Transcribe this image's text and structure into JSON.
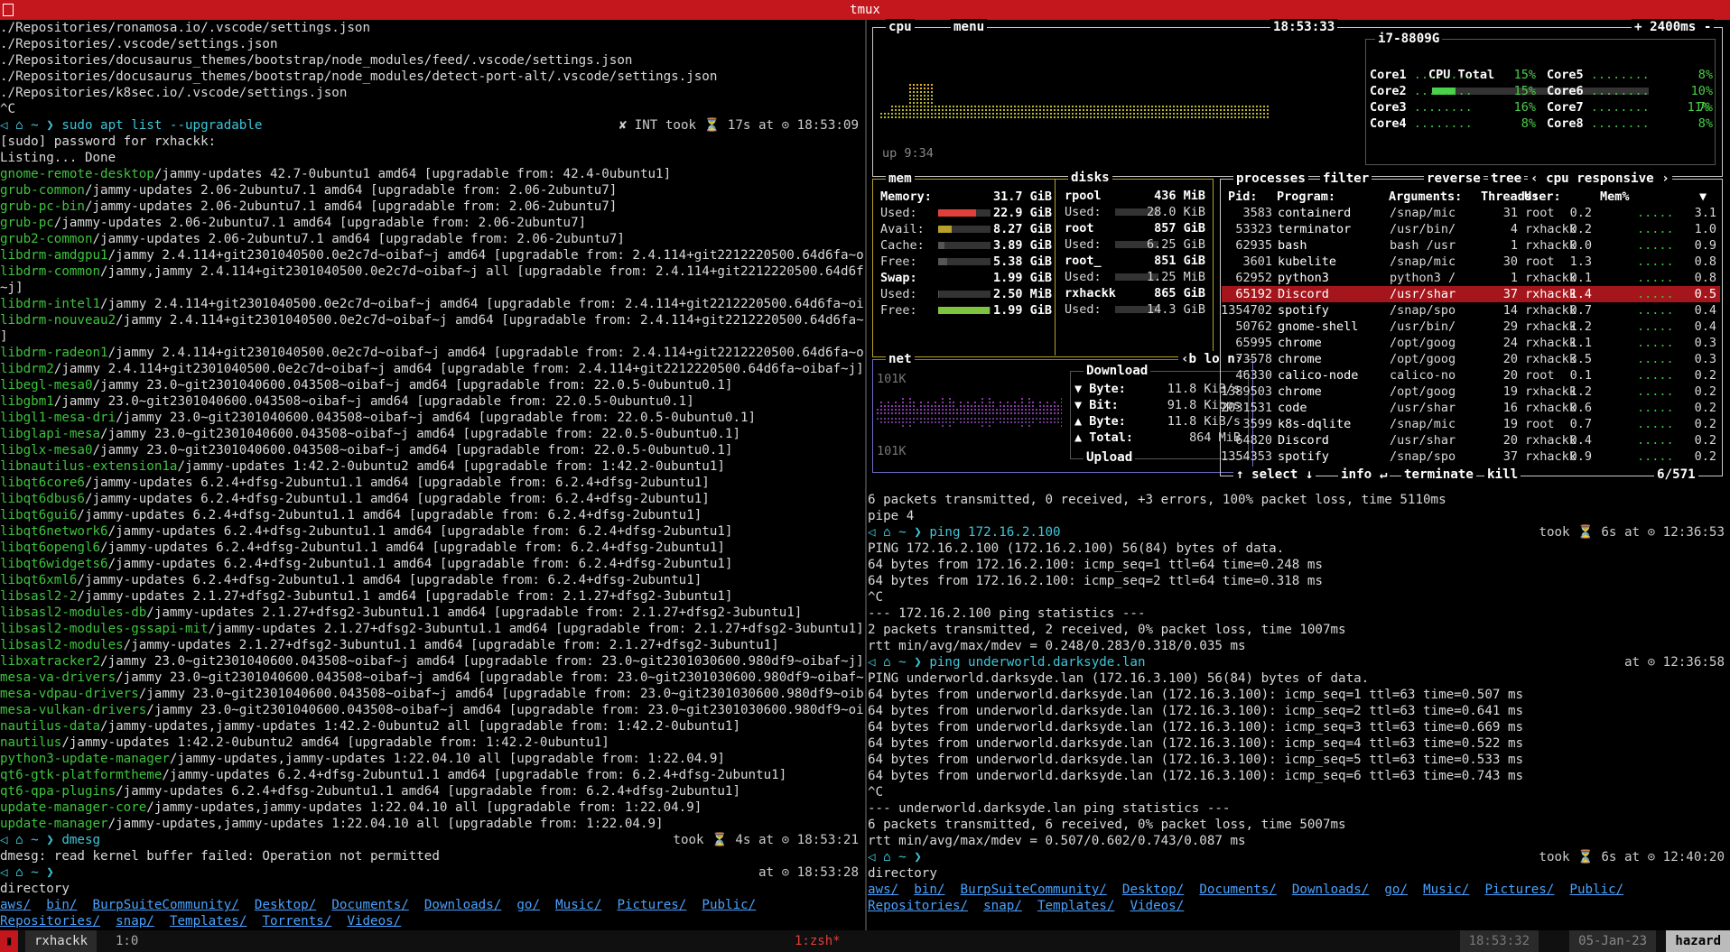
{
  "window": {
    "title": "tmux"
  },
  "left_pane": {
    "lines": [
      {
        "t": "./Repositories/ronamosa.io/.vscode/settings.json"
      },
      {
        "t": "./Repositories/.vscode/settings.json"
      },
      {
        "t": "./Repositories/docusaurus_themes/bootstrap/node_modules/feed/.vscode/settings.json"
      },
      {
        "t": "./Repositories/docusaurus_themes/bootstrap/node_modules/detect-port-alt/.vscode/settings.json"
      },
      {
        "t": "./Repositories/k8sec.io/.vscode/settings.json"
      },
      {
        "t": "^C"
      },
      {
        "t": "◁ ⌂ ~ ❯ sudo apt list --upgradable",
        "right": "✘ INT took ⏳ 17s at ⊙ 18:53:09",
        "prompt": true
      },
      {
        "t": "[sudo] password for rxhackk:"
      },
      {
        "t": "Listing... Done"
      },
      {
        "pkg": "gnome-remote-desktop",
        "t": "/jammy-updates 42.7-0ubuntu1 amd64 [upgradable from: 42.4-0ubuntu1]"
      },
      {
        "pkg": "grub-common",
        "t": "/jammy-updates 2.06-2ubuntu7.1 amd64 [upgradable from: 2.06-2ubuntu7]"
      },
      {
        "pkg": "grub-pc-bin",
        "t": "/jammy-updates 2.06-2ubuntu7.1 amd64 [upgradable from: 2.06-2ubuntu7]"
      },
      {
        "pkg": "grub-pc",
        "t": "/jammy-updates 2.06-2ubuntu7.1 amd64 [upgradable from: 2.06-2ubuntu7]"
      },
      {
        "pkg": "grub2-common",
        "t": "/jammy-updates 2.06-2ubuntu7.1 amd64 [upgradable from: 2.06-2ubuntu7]"
      },
      {
        "pkg": "libdrm-amdgpu1",
        "t": "/jammy 2.4.114+git2301040500.0e2c7d~oibaf~j amd64 [upgradable from: 2.4.114+git2212220500.64d6fa~oibaf~j]"
      },
      {
        "pkg": "libdrm-common",
        "t": "/jammy,jammy 2.4.114+git2301040500.0e2c7d~oibaf~j all [upgradable from: 2.4.114+git2212220500.64d6fa~oibaf"
      },
      {
        "t": "~j]"
      },
      {
        "pkg": "libdrm-intel1",
        "t": "/jammy 2.4.114+git2301040500.0e2c7d~oibaf~j amd64 [upgradable from: 2.4.114+git2212220500.64d6fa~oibaf~j]"
      },
      {
        "pkg": "libdrm-nouveau2",
        "t": "/jammy 2.4.114+git2301040500.0e2c7d~oibaf~j amd64 [upgradable from: 2.4.114+git2212220500.64d6fa~oibaf~j"
      },
      {
        "t": "]"
      },
      {
        "pkg": "libdrm-radeon1",
        "t": "/jammy 2.4.114+git2301040500.0e2c7d~oibaf~j amd64 [upgradable from: 2.4.114+git2212220500.64d6fa~oibaf~j]"
      },
      {
        "pkg": "libdrm2",
        "t": "/jammy 2.4.114+git2301040500.0e2c7d~oibaf~j amd64 [upgradable from: 2.4.114+git2212220500.64d6fa~oibaf~j]"
      },
      {
        "pkg": "libegl-mesa0",
        "t": "/jammy 23.0~git2301040600.043508~oibaf~j amd64 [upgradable from: 22.0.5-0ubuntu0.1]"
      },
      {
        "pkg": "libgbm1",
        "t": "/jammy 23.0~git2301040600.043508~oibaf~j amd64 [upgradable from: 22.0.5-0ubuntu0.1]"
      },
      {
        "pkg": "libgl1-mesa-dri",
        "t": "/jammy 23.0~git2301040600.043508~oibaf~j amd64 [upgradable from: 22.0.5-0ubuntu0.1]"
      },
      {
        "pkg": "libglapi-mesa",
        "t": "/jammy 23.0~git2301040600.043508~oibaf~j amd64 [upgradable from: 22.0.5-0ubuntu0.1]"
      },
      {
        "pkg": "libglx-mesa0",
        "t": "/jammy 23.0~git2301040600.043508~oibaf~j amd64 [upgradable from: 22.0.5-0ubuntu0.1]"
      },
      {
        "pkg": "libnautilus-extension1a",
        "t": "/jammy-updates 1:42.2-0ubuntu2 amd64 [upgradable from: 1:42.2-0ubuntu1]"
      },
      {
        "pkg": "libqt6core6",
        "t": "/jammy-updates 6.2.4+dfsg-2ubuntu1.1 amd64 [upgradable from: 6.2.4+dfsg-2ubuntu1]"
      },
      {
        "pkg": "libqt6dbus6",
        "t": "/jammy-updates 6.2.4+dfsg-2ubuntu1.1 amd64 [upgradable from: 6.2.4+dfsg-2ubuntu1]"
      },
      {
        "pkg": "libqt6gui6",
        "t": "/jammy-updates 6.2.4+dfsg-2ubuntu1.1 amd64 [upgradable from: 6.2.4+dfsg-2ubuntu1]"
      },
      {
        "pkg": "libqt6network6",
        "t": "/jammy-updates 6.2.4+dfsg-2ubuntu1.1 amd64 [upgradable from: 6.2.4+dfsg-2ubuntu1]"
      },
      {
        "pkg": "libqt6opengl6",
        "t": "/jammy-updates 6.2.4+dfsg-2ubuntu1.1 amd64 [upgradable from: 6.2.4+dfsg-2ubuntu1]"
      },
      {
        "pkg": "libqt6widgets6",
        "t": "/jammy-updates 6.2.4+dfsg-2ubuntu1.1 amd64 [upgradable from: 6.2.4+dfsg-2ubuntu1]"
      },
      {
        "pkg": "libqt6xml6",
        "t": "/jammy-updates 6.2.4+dfsg-2ubuntu1.1 amd64 [upgradable from: 6.2.4+dfsg-2ubuntu1]"
      },
      {
        "pkg": "libsasl2-2",
        "t": "/jammy-updates 2.1.27+dfsg2-3ubuntu1.1 amd64 [upgradable from: 2.1.27+dfsg2-3ubuntu1]"
      },
      {
        "pkg": "libsasl2-modules-db",
        "t": "/jammy-updates 2.1.27+dfsg2-3ubuntu1.1 amd64 [upgradable from: 2.1.27+dfsg2-3ubuntu1]"
      },
      {
        "pkg": "libsasl2-modules-gssapi-mit",
        "t": "/jammy-updates 2.1.27+dfsg2-3ubuntu1.1 amd64 [upgradable from: 2.1.27+dfsg2-3ubuntu1]"
      },
      {
        "pkg": "libsasl2-modules",
        "t": "/jammy-updates 2.1.27+dfsg2-3ubuntu1.1 amd64 [upgradable from: 2.1.27+dfsg2-3ubuntu1]"
      },
      {
        "pkg": "libxatracker2",
        "t": "/jammy 23.0~git2301040600.043508~oibaf~j amd64 [upgradable from: 23.0~git2301030600.980df9~oibaf~j]"
      },
      {
        "pkg": "mesa-va-drivers",
        "t": "/jammy 23.0~git2301040600.043508~oibaf~j amd64 [upgradable from: 23.0~git2301030600.980df9~oibaf~j]"
      },
      {
        "pkg": "mesa-vdpau-drivers",
        "t": "/jammy 23.0~git2301040600.043508~oibaf~j amd64 [upgradable from: 23.0~git2301030600.980df9~oibaf~j]"
      },
      {
        "pkg": "mesa-vulkan-drivers",
        "t": "/jammy 23.0~git2301040600.043508~oibaf~j amd64 [upgradable from: 23.0~git2301030600.980df9~oibaf~j]"
      },
      {
        "pkg": "nautilus-data",
        "t": "/jammy-updates,jammy-updates 1:42.2-0ubuntu2 all [upgradable from: 1:42.2-0ubuntu1]"
      },
      {
        "pkg": "nautilus",
        "t": "/jammy-updates 1:42.2-0ubuntu2 amd64 [upgradable from: 1:42.2-0ubuntu1]"
      },
      {
        "pkg": "python3-update-manager",
        "t": "/jammy-updates,jammy-updates 1:22.04.10 all [upgradable from: 1:22.04.9]"
      },
      {
        "pkg": "qt6-gtk-platformtheme",
        "t": "/jammy-updates 6.2.4+dfsg-2ubuntu1.1 amd64 [upgradable from: 6.2.4+dfsg-2ubuntu1]"
      },
      {
        "pkg": "qt6-qpa-plugins",
        "t": "/jammy-updates 6.2.4+dfsg-2ubuntu1.1 amd64 [upgradable from: 6.2.4+dfsg-2ubuntu1]"
      },
      {
        "pkg": "update-manager-core",
        "t": "/jammy-updates,jammy-updates 1:22.04.10 all [upgradable from: 1:22.04.9]"
      },
      {
        "pkg": "update-manager",
        "t": "/jammy-updates,jammy-updates 1:22.04.10 all [upgradable from: 1:22.04.9]"
      },
      {
        "t": "◁ ⌂ ~ ❯ dmesg",
        "right": "took ⏳ 4s at ⊙ 18:53:21",
        "prompt": true
      },
      {
        "t": "dmesg: read kernel buffer failed: Operation not permitted"
      },
      {
        "t": "◁ ⌂ ~ ❯",
        "right": "at ⊙ 18:53:28",
        "prompt": true
      },
      {
        "t": "directory"
      },
      {
        "dirs": [
          "aws/",
          "bin/",
          "BurpSuiteCommunity/",
          "Desktop/",
          "Documents/",
          "Downloads/",
          "go/",
          "Music/",
          "Pictures/",
          "Public/"
        ]
      },
      {
        "dirs": [
          "Repositories/",
          "snap/",
          "Templates/",
          "Torrents/",
          "Videos/"
        ]
      }
    ]
  },
  "right_pane": {
    "lines": [
      {
        "t": "6 packets transmitted, 0 received, +3 errors, 100% packet loss, time 5110ms"
      },
      {
        "t": "pipe 4"
      },
      {
        "t": "◁ ⌂ ~ ❯ ping 172.16.2.100",
        "right": "took ⏳ 6s at ⊙ 12:36:53",
        "prompt": true
      },
      {
        "t": "PING 172.16.2.100 (172.16.2.100) 56(84) bytes of data."
      },
      {
        "t": "64 bytes from 172.16.2.100: icmp_seq=1 ttl=64 time=0.248 ms"
      },
      {
        "t": "64 bytes from 172.16.2.100: icmp_seq=2 ttl=64 time=0.318 ms"
      },
      {
        "t": "^C"
      },
      {
        "t": "--- 172.16.2.100 ping statistics ---"
      },
      {
        "t": "2 packets transmitted, 2 received, 0% packet loss, time 1007ms"
      },
      {
        "t": "rtt min/avg/max/mdev = 0.248/0.283/0.318/0.035 ms"
      },
      {
        "t": "◁ ⌂ ~ ❯ ping underworld.darksyde.lan",
        "right": "at ⊙ 12:36:58",
        "prompt": true
      },
      {
        "t": "PING underworld.darksyde.lan (172.16.3.100) 56(84) bytes of data."
      },
      {
        "t": "64 bytes from underworld.darksyde.lan (172.16.3.100): icmp_seq=1 ttl=63 time=0.507 ms"
      },
      {
        "t": "64 bytes from underworld.darksyde.lan (172.16.3.100): icmp_seq=2 ttl=63 time=0.641 ms"
      },
      {
        "t": "64 bytes from underworld.darksyde.lan (172.16.3.100): icmp_seq=3 ttl=63 time=0.669 ms"
      },
      {
        "t": "64 bytes from underworld.darksyde.lan (172.16.3.100): icmp_seq=4 ttl=63 time=0.522 ms"
      },
      {
        "t": "64 bytes from underworld.darksyde.lan (172.16.3.100): icmp_seq=5 ttl=63 time=0.533 ms"
      },
      {
        "t": "64 bytes from underworld.darksyde.lan (172.16.3.100): icmp_seq=6 ttl=63 time=0.743 ms"
      },
      {
        "t": "^C"
      },
      {
        "t": "--- underworld.darksyde.lan ping statistics ---"
      },
      {
        "t": "6 packets transmitted, 6 received, 0% packet loss, time 5007ms"
      },
      {
        "t": "rtt min/avg/max/mdev = 0.507/0.602/0.743/0.087 ms"
      },
      {
        "t": "◁ ⌂ ~ ❯",
        "right": "took ⏳ 6s at ⊙ 12:40:20",
        "prompt": true
      },
      {
        "t": "directory"
      },
      {
        "dirs": [
          "aws/",
          "bin/",
          "BurpSuiteCommunity/",
          "Desktop/",
          "Documents/",
          "Downloads/",
          "go/",
          "Music/",
          "Pictures/",
          "Public/"
        ]
      },
      {
        "dirs": [
          "Repositories/",
          "snap/",
          "Templates/",
          "Videos/"
        ]
      }
    ]
  },
  "btop": {
    "cpu": {
      "tabs": [
        "cpu",
        "menu"
      ],
      "clock": "18:53:33",
      "rate": "+ 2400ms -",
      "model": "i7-8809G",
      "uptime": "up 9:34",
      "total_label": "CPU Total",
      "total": "11%",
      "total_fill": 0.11,
      "cores": [
        {
          "n": "Core1",
          "v": "15%"
        },
        {
          "n": "Core5",
          "v": "8%"
        },
        {
          "n": "Core2",
          "v": "15%"
        },
        {
          "n": "Core6",
          "v": "10%"
        },
        {
          "n": "Core3",
          "v": "16%"
        },
        {
          "n": "Core7",
          "v": "7%"
        },
        {
          "n": "Core4",
          "v": "8%"
        },
        {
          "n": "Core8",
          "v": "8%"
        }
      ]
    },
    "mem": {
      "title": "mem",
      "rows": [
        {
          "l": "Memory:",
          "v": "31.7 GiB",
          "bold": true
        },
        {
          "l": "Used:",
          "v": "22.9 GiB",
          "fill": 0.72,
          "color": "#e0403a"
        },
        {
          "l": "Avail:",
          "v": "8.27 GiB",
          "fill": 0.26,
          "color": "#b8a12a"
        },
        {
          "l": "Cache:",
          "v": "3.89 GiB",
          "fill": 0.12,
          "color": "#555"
        },
        {
          "l": "Free:",
          "v": "5.38 GiB",
          "fill": 0.17,
          "color": "#555"
        },
        {
          "l": "Swap:",
          "v": "1.99 GiB",
          "bold": true
        },
        {
          "l": "Used:",
          "v": "2.50 MiB",
          "fill": 0.01,
          "color": "#555"
        },
        {
          "l": "Free:",
          "v": "1.99 GiB",
          "fill": 0.99,
          "color": "#7ec43e"
        }
      ]
    },
    "disks": {
      "title": "disks",
      "rows": [
        {
          "l": "rpool",
          "v": "436 MiB",
          "bold": true
        },
        {
          "l": "Used:",
          "v": "28.0 KiB"
        },
        {
          "l": "root",
          "v": "857 GiB",
          "bold": true
        },
        {
          "l": "Used:",
          "v": "6.25 GiB"
        },
        {
          "l": "root_",
          "v": "851 GiB",
          "bold": true
        },
        {
          "l": "Used:",
          "v": "1.25 MiB"
        },
        {
          "l": "rxhackk",
          "v": "865 GiB",
          "bold": true
        },
        {
          "l": "Used:",
          "v": "14.3 GiB"
        }
      ]
    },
    "net": {
      "title": "net",
      "tabs": "‹b lo n›",
      "scale_top": "101K",
      "scale_bottom": "101K",
      "download_label": "Download",
      "upload_label": "Upload",
      "rows": [
        {
          "l": "▼ Byte:",
          "v": "11.8 KiB/s"
        },
        {
          "l": "▼ Bit:",
          "v": "91.8 Kibps"
        },
        {
          "l": "▲ Byte:",
          "v": "11.8 KiB/s"
        },
        {
          "l": "▲ Total:",
          "v": "864 MiB"
        }
      ]
    },
    "proc": {
      "tabs": [
        "processes",
        "filter",
        "reverse",
        "tree",
        "‹ cpu responsive ›"
      ],
      "headers": [
        "Pid:",
        "Program:",
        "Arguments:",
        "Threads:",
        "User:",
        "Mem%",
        "▼"
      ],
      "rows": [
        {
          "pid": "3583",
          "prog": "containerd",
          "args": "/snap/mic",
          "thr": "31",
          "user": "root",
          "mem": "0.2",
          "cpu": "3.1"
        },
        {
          "pid": "53323",
          "prog": "terminator",
          "args": "/usr/bin/",
          "thr": "4",
          "user": "rxhackk",
          "mem": "0.2",
          "cpu": "1.0"
        },
        {
          "pid": "62935",
          "prog": "bash",
          "args": "bash /usr",
          "thr": "1",
          "user": "rxhackk",
          "mem": "0.0",
          "cpu": "0.9"
        },
        {
          "pid": "3601",
          "prog": "kubelite",
          "args": "/snap/mic",
          "thr": "30",
          "user": "root",
          "mem": "1.3",
          "cpu": "0.8"
        },
        {
          "pid": "62952",
          "prog": "python3",
          "args": "python3 /",
          "thr": "1",
          "user": "rxhackk",
          "mem": "0.1",
          "cpu": "0.8"
        },
        {
          "pid": "65192",
          "prog": "Discord",
          "args": "/usr/shar",
          "thr": "37",
          "user": "rxhackk",
          "mem": "1.4",
          "cpu": "0.5",
          "sel": true
        },
        {
          "pid": "1354702",
          "prog": "spotify",
          "args": "/snap/spo",
          "thr": "14",
          "user": "rxhackk",
          "mem": "0.7",
          "cpu": "0.4"
        },
        {
          "pid": "50762",
          "prog": "gnome-shell",
          "args": "/usr/bin/",
          "thr": "29",
          "user": "rxhackk",
          "mem": "1.2",
          "cpu": "0.4"
        },
        {
          "pid": "65995",
          "prog": "chrome",
          "args": "/opt/goog",
          "thr": "24",
          "user": "rxhackk",
          "mem": "1.1",
          "cpu": "0.3"
        },
        {
          "pid": "73578",
          "prog": "chrome",
          "args": "/opt/goog",
          "thr": "20",
          "user": "rxhackk",
          "mem": "3.5",
          "cpu": "0.3"
        },
        {
          "pid": "46330",
          "prog": "calico-node",
          "args": "calico-no",
          "thr": "20",
          "user": "root",
          "mem": "0.1",
          "cpu": "0.2"
        },
        {
          "pid": "1389503",
          "prog": "chrome",
          "args": "/opt/goog",
          "thr": "19",
          "user": "rxhackk",
          "mem": "1.2",
          "cpu": "0.2"
        },
        {
          "pid": "2031531",
          "prog": "code",
          "args": "/usr/shar",
          "thr": "16",
          "user": "rxhackk",
          "mem": "0.6",
          "cpu": "0.2"
        },
        {
          "pid": "3599",
          "prog": "k8s-dqlite",
          "args": "/snap/mic",
          "thr": "19",
          "user": "root",
          "mem": "0.7",
          "cpu": "0.2"
        },
        {
          "pid": "64820",
          "prog": "Discord",
          "args": "/usr/shar",
          "thr": "20",
          "user": "rxhackk",
          "mem": "0.4",
          "cpu": "0.2"
        },
        {
          "pid": "1354353",
          "prog": "spotify",
          "args": "/snap/spo",
          "thr": "37",
          "user": "rxhackk",
          "mem": "0.9",
          "cpu": "0.2"
        }
      ],
      "footer": [
        "↑ select ↓",
        "info ↵",
        "terminate",
        "kill"
      ],
      "count": "6/571"
    }
  },
  "statusbar": {
    "left": "rxhackk",
    "win": "1:0",
    "mid": "1:zsh*",
    "time": "18:53:32",
    "date": "05-Jan-23",
    "host": "hazard"
  }
}
